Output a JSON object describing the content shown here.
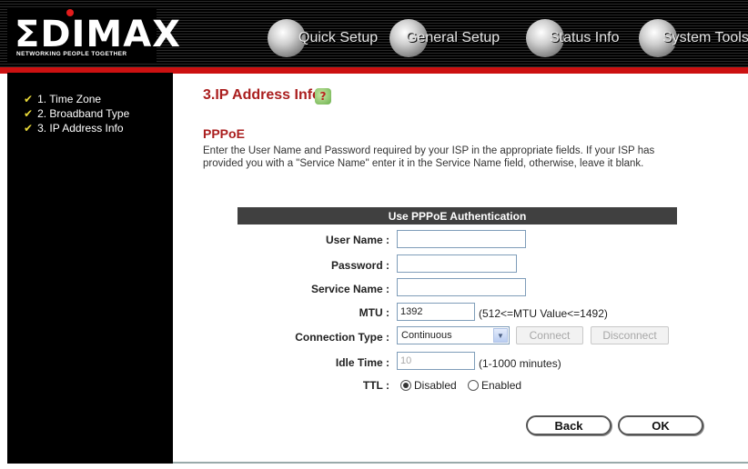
{
  "header": {
    "logo_text": "ΣDIMAX",
    "logo_tagline": "NETWORKING PEOPLE TOGETHER",
    "nav": [
      {
        "label": "Quick Setup"
      },
      {
        "label": "General Setup"
      },
      {
        "label": "Status Info"
      },
      {
        "label": "System Tools"
      }
    ]
  },
  "sidebar": {
    "items": [
      {
        "label": "1. Time Zone"
      },
      {
        "label": "2. Broadband Type"
      },
      {
        "label": "3. IP Address Info"
      }
    ]
  },
  "main": {
    "title": "3.IP Address Info",
    "section_title": "PPPoE",
    "description": "Enter the User Name and Password required by your ISP in the appropriate fields. If your ISP has provided you with a \"Service Name\" enter it in the Service Name field, otherwise, leave it blank.",
    "table_header": "Use PPPoE Authentication",
    "fields": {
      "user_name": {
        "label": "User Name :",
        "value": ""
      },
      "password": {
        "label": "Password :",
        "value": ""
      },
      "service_name": {
        "label": "Service Name :",
        "value": ""
      },
      "mtu": {
        "label": "MTU :",
        "value": "1392",
        "hint": "(512<=MTU Value<=1492)"
      },
      "connection_type": {
        "label": "Connection Type :",
        "value": "Continuous",
        "connect_label": "Connect",
        "disconnect_label": "Disconnect"
      },
      "idle_time": {
        "label": "Idle Time :",
        "value": "10",
        "hint": "(1-1000 minutes)"
      },
      "ttl": {
        "label": "TTL :",
        "options": [
          "Disabled",
          "Enabled"
        ],
        "selected": "Disabled"
      }
    },
    "buttons": {
      "back": "Back",
      "ok": "OK"
    }
  },
  "colors": {
    "accent_red": "#aa1e1e",
    "header_red": "#cc1111",
    "check_yellow": "#e8d838"
  }
}
